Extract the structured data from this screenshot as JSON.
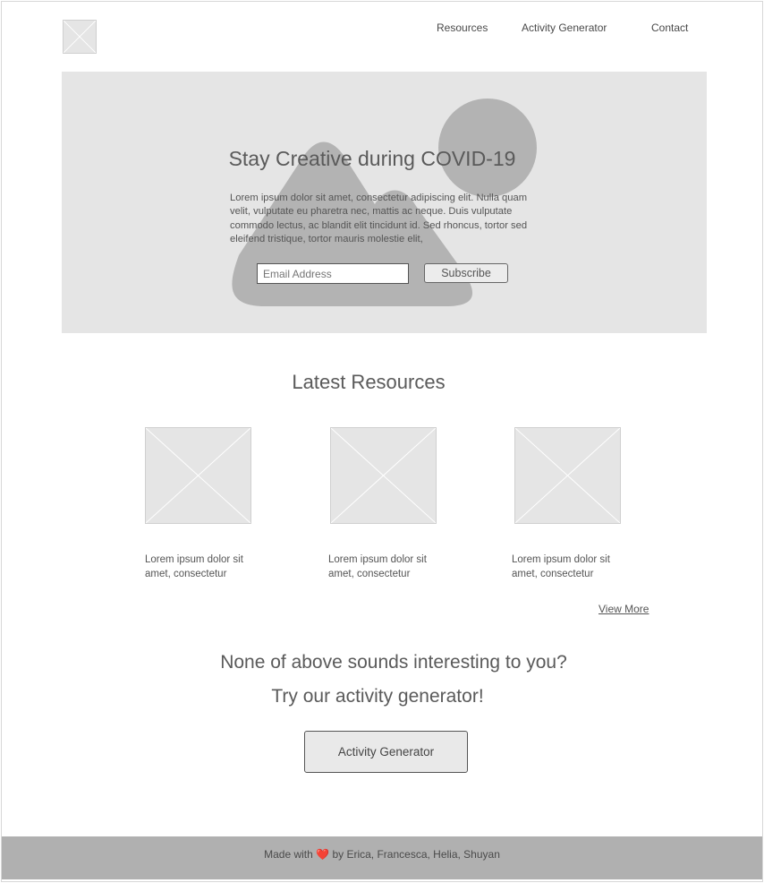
{
  "header": {
    "logo_icon": "image-placeholder-icon",
    "nav": [
      {
        "label": "Resources"
      },
      {
        "label": "Activity Generator"
      },
      {
        "label": "Contact"
      }
    ]
  },
  "hero": {
    "title": "Stay Creative during COVID-19",
    "body": "Lorem ipsum dolor sit amet, consectetur adipiscing elit. Nulla quam velit, vulputate eu pharetra nec, mattis ac neque. Duis vulputate commodo lectus, ac blandit elit tincidunt id. Sed rhoncus, tortor sed eleifend tristique, tortor mauris molestie elit,",
    "email_placeholder": "Email Address",
    "subscribe_label": "Subscribe",
    "background_icon": "landscape-image-icon"
  },
  "resources": {
    "title": "Latest Resources",
    "cards": [
      {
        "image_icon": "image-placeholder-icon",
        "text": "Lorem ipsum dolor sit amet, consectetur"
      },
      {
        "image_icon": "image-placeholder-icon",
        "text": "Lorem ipsum dolor sit amet, consectetur"
      },
      {
        "image_icon": "image-placeholder-icon",
        "text": "Lorem ipsum dolor sit amet, consectetur"
      }
    ],
    "view_more_label": "View More"
  },
  "cta": {
    "line1": "None of above sounds interesting to you?",
    "line2": "Try our activity generator!",
    "button_label": "Activity Generator"
  },
  "footer": {
    "prefix": "Made with",
    "heart_icon": "heart-icon",
    "suffix": "by Erica, Francesca, Helia, Shuyan"
  },
  "colors": {
    "hero_bg": "#e5e5e5",
    "shape_gray": "#b3b3b3",
    "footer_bg": "#b0b0b0",
    "heart": "#e02020"
  }
}
